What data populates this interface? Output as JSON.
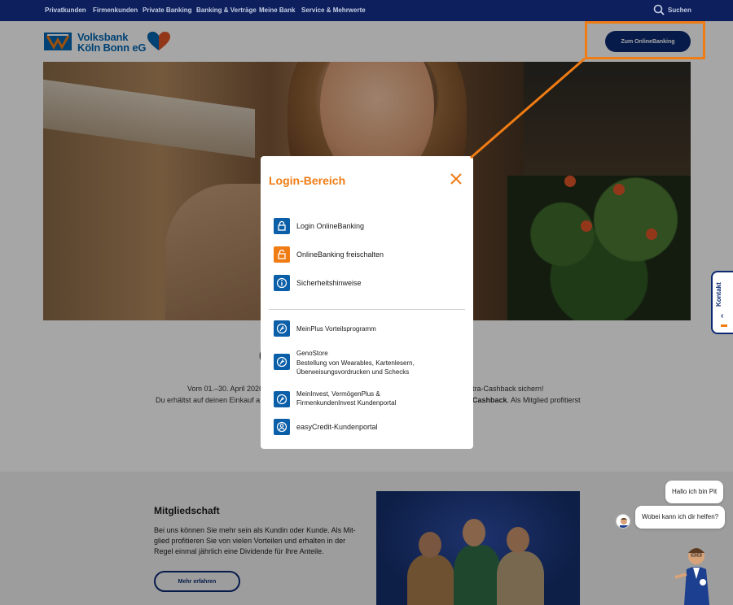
{
  "topnav": {
    "items": [
      "Privatkunden",
      "Firmenkunden",
      "Private Banking",
      "Banking & Verträge",
      "Meine Bank",
      "Service & Mehrwerte"
    ],
    "search_label": "Suchen"
  },
  "header": {
    "logo_line1": "Volksbank",
    "logo_line2": "Köln Bonn eG",
    "onlinebanking_button": "Zum OnlineBanking"
  },
  "promo": {
    "line1_left": "Vom 01.–30. April 2026",
    "line1_right": "tra-Cashback sichern!",
    "line2_left": "Du erhältst auf deinen Einkauf a",
    "line2_right_bold": "Cashback",
    "line2_right_rest": ". Als Mitglied profitierst"
  },
  "membership": {
    "title": "Mitgliedschaft",
    "text": "Bei uns können Sie mehr sein als Kundin oder Kunde. Als Mit-glied profitieren Sie von vielen Vorteilen und erhalten in der Regel einmal jährlich eine Dividende für Ihre Anteile.",
    "button": "Mehr erfahren"
  },
  "kontakt": {
    "label": "Kontakt"
  },
  "chat": {
    "bubble1": "Hallo ich bin Pit",
    "bubble2": "Wobei kann ich dir helfen?"
  },
  "modal": {
    "title": "Login-Bereich",
    "primary_items": [
      {
        "label": "Login OnlineBanking",
        "icon": "lock-icon"
      },
      {
        "label": "OnlineBanking freischalten",
        "icon": "unlock-icon"
      },
      {
        "label": "Sicherheitshinweise",
        "icon": "info-icon"
      }
    ],
    "secondary_items": [
      {
        "label": "MeinPlus Vorteilsprogramm",
        "icon": "meinplus-icon"
      },
      {
        "label": "GenoStore",
        "sub1": "Bestellung von Wearables, Kartenlesern,",
        "sub2": "Überweisungsvordrucken und Schecks",
        "icon": "genostore-icon"
      },
      {
        "label": "MeinInvest, VermögenPlus &",
        "sub1": "FirmenkundenInvest Kundenportal",
        "icon": "invest-icon"
      },
      {
        "label": "easyCredit-Kundenportal",
        "icon": "easycredit-icon"
      }
    ]
  },
  "colors": {
    "brand_blue": "#0b2a73",
    "accent_orange": "#f07c14",
    "icon_blue": "#0b5fa8",
    "nav_bg": "#0d1f5c"
  }
}
